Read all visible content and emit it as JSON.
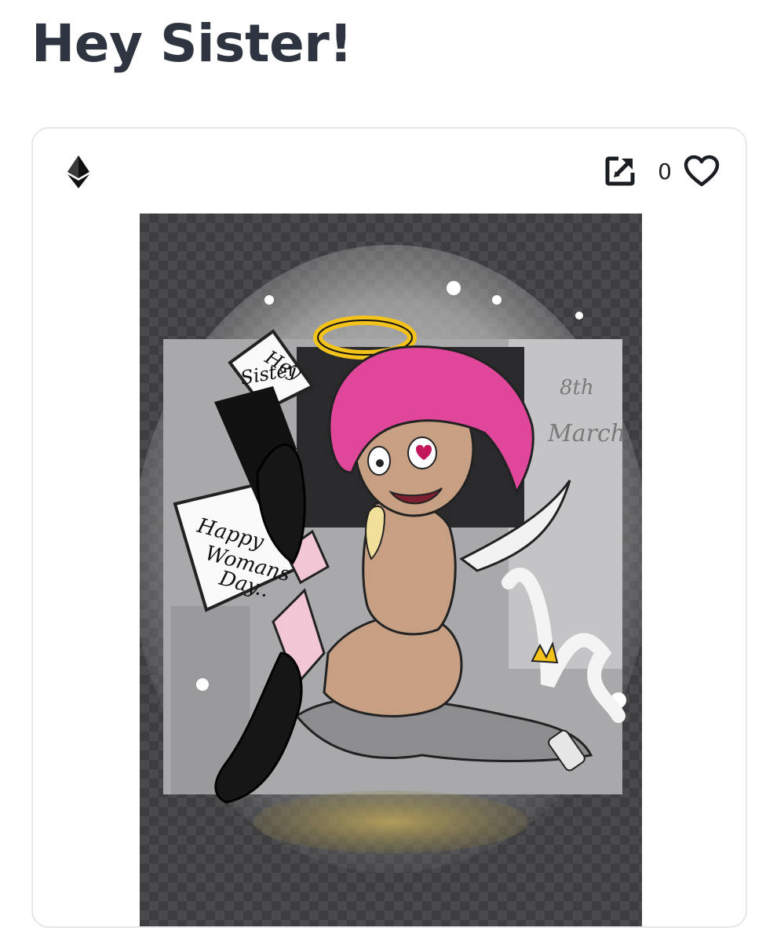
{
  "page": {
    "title": "Hey Sister!"
  },
  "card": {
    "chain_icon": "ethereum-icon",
    "open_icon": "open-external-icon",
    "like_icon": "heart-outline-icon",
    "like_count": "0"
  },
  "artwork": {
    "sign_top": [
      "Hey",
      "Sister"
    ],
    "sign_left": [
      "Happy",
      "Womans",
      "Day.."
    ],
    "date_text": [
      "8th",
      "March"
    ]
  },
  "colors": {
    "title": "#2f3540",
    "border": "#e6e7ea",
    "hair": "#e0469a",
    "halo": "#f3c21b",
    "checker_dark": "#3e3e41",
    "checker_light": "#4a4a4d"
  }
}
